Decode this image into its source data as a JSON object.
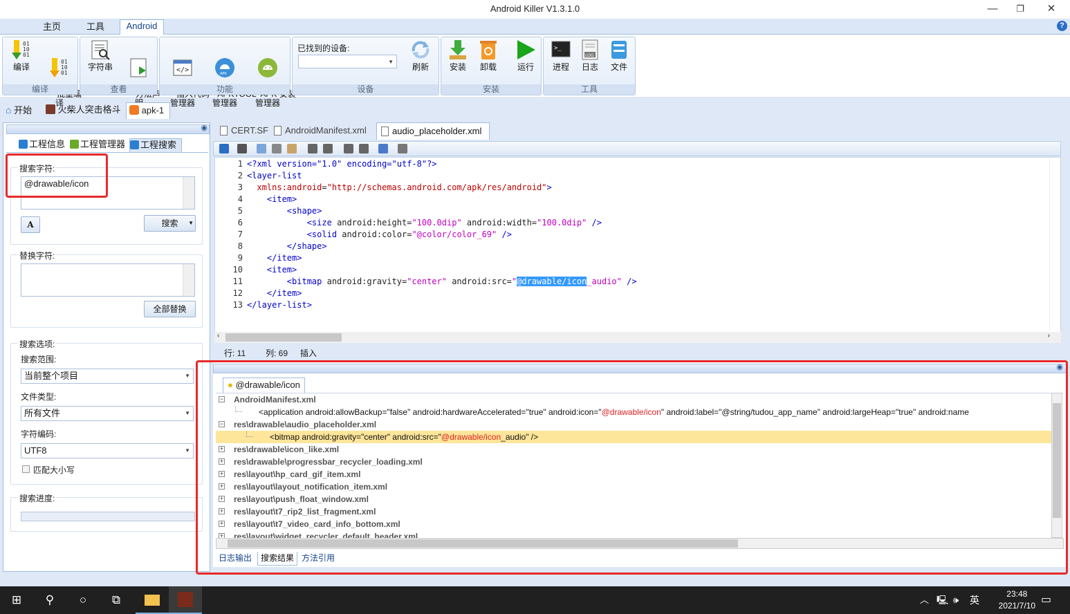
{
  "window": {
    "title": "Android Killer V1.3.1.0",
    "minimize": "—",
    "maximize": "❐",
    "close": "✕"
  },
  "menu_tabs": [
    "主页",
    "工具",
    "Android"
  ],
  "help": "?",
  "ribbon": {
    "groups": [
      {
        "label": "编译",
        "buttons": [
          {
            "label": "编译"
          },
          {
            "label": "批量编\n译"
          }
        ]
      },
      {
        "label": "查看",
        "buttons": [
          {
            "label": "字符串"
          },
          {
            "label": "方法声\n明"
          }
        ]
      },
      {
        "label": "功能",
        "buttons": [
          {
            "label": "插入代码\n管理器"
          },
          {
            "label": "APKTOOL\n管理器"
          },
          {
            "label": "APK 安装\n管理器"
          }
        ]
      },
      {
        "label": "设备",
        "device_label": "已找到的设备:",
        "buttons": [
          {
            "label": "刷新"
          }
        ]
      },
      {
        "label": "安装",
        "buttons": [
          {
            "label": "安装"
          },
          {
            "label": "卸载"
          }
        ]
      },
      {
        "label": "",
        "buttons": [
          {
            "label": "运行"
          }
        ]
      },
      {
        "label": "工具",
        "buttons": [
          {
            "label": "进程"
          },
          {
            "label": "日志"
          },
          {
            "label": "文件"
          }
        ]
      }
    ]
  },
  "doc_tabs": [
    "开始",
    "火柴人突击格斗",
    "apk-1"
  ],
  "left_panel": {
    "tabs": [
      "工程信息",
      "工程管理器",
      "工程搜索"
    ],
    "search_label": "搜索字符:",
    "search_value": "@drawable/icon",
    "search_button": "搜索",
    "replace_label": "替换字符:",
    "replace_all_button": "全部替换",
    "options_label": "搜索选项:",
    "scope_label": "搜索范围:",
    "scope_value": "当前整个项目",
    "filetype_label": "文件类型:",
    "filetype_value": "所有文件",
    "encoding_label": "字符编码:",
    "encoding_value": "UTF8",
    "match_case": "匹配大小写",
    "progress_label": "搜索进度:"
  },
  "editor": {
    "tabs": [
      "CERT.SF",
      "AndroidManifest.xml",
      "audio_placeholder.xml"
    ],
    "status": {
      "line": "行: 11",
      "col": "列: 69",
      "mode": "插入"
    }
  },
  "code_lines": [
    {
      "n": "1",
      "parts": [
        [
          "c-tag",
          "<?xml version=\"1.0\" encoding=\"utf-8\"?>"
        ]
      ]
    },
    {
      "n": "2",
      "parts": [
        [
          "c-tag",
          "<layer-list"
        ]
      ]
    },
    {
      "n": "3",
      "parts": [
        [
          "",
          "  "
        ],
        [
          "c-attr",
          "xmlns:android"
        ],
        [
          "c-attr2",
          "="
        ],
        [
          "c-attr",
          "\"http://schemas.android.com/apk/res/android\""
        ],
        [
          "c-tag",
          ">"
        ]
      ]
    },
    {
      "n": "4",
      "parts": [
        [
          "",
          "    "
        ],
        [
          "c-tag",
          "<item>"
        ]
      ]
    },
    {
      "n": "5",
      "parts": [
        [
          "",
          "        "
        ],
        [
          "c-tag",
          "<shape>"
        ]
      ]
    },
    {
      "n": "6",
      "parts": [
        [
          "",
          "            "
        ],
        [
          "c-tag",
          "<size "
        ],
        [
          "c-attr2",
          "android:height="
        ],
        [
          "c-val",
          "\"100.0dip\""
        ],
        [
          "c-attr2",
          " android:width="
        ],
        [
          "c-val",
          "\"100.0dip\""
        ],
        [
          "c-tag",
          " />"
        ]
      ]
    },
    {
      "n": "7",
      "parts": [
        [
          "",
          "            "
        ],
        [
          "c-tag",
          "<solid "
        ],
        [
          "c-attr2",
          "android:color="
        ],
        [
          "c-val",
          "\"@color/color_69\""
        ],
        [
          "c-tag",
          " />"
        ]
      ]
    },
    {
      "n": "8",
      "parts": [
        [
          "",
          "        "
        ],
        [
          "c-tag",
          "</shape>"
        ]
      ]
    },
    {
      "n": "9",
      "parts": [
        [
          "",
          "    "
        ],
        [
          "c-tag",
          "</item>"
        ]
      ]
    },
    {
      "n": "10",
      "parts": [
        [
          "",
          "    "
        ],
        [
          "c-tag",
          "<item>"
        ]
      ]
    },
    {
      "n": "11",
      "parts": [
        [
          "",
          "        "
        ],
        [
          "c-tag",
          "<bitmap "
        ],
        [
          "c-attr2",
          "android:gravity="
        ],
        [
          "c-val",
          "\"center\""
        ],
        [
          "c-attr2",
          " android:src="
        ],
        [
          "c-val",
          "\""
        ],
        [
          "hl",
          "@drawable/icon"
        ],
        [
          "c-val",
          "_audio\""
        ],
        [
          "c-tag",
          " />"
        ]
      ]
    },
    {
      "n": "12",
      "parts": [
        [
          "",
          "    "
        ],
        [
          "c-tag",
          "</item>"
        ]
      ]
    },
    {
      "n": "13",
      "parts": [
        [
          "c-tag",
          "</layer-list>"
        ]
      ]
    }
  ],
  "results": {
    "tab": "@drawable/icon",
    "rows": [
      {
        "type": "file",
        "pm": "⊟",
        "text": "AndroidManifest.xml"
      },
      {
        "type": "match",
        "pre": "<application android:allowBackup=\"false\" android:hardwareAccelerated=\"true\" android:icon=\"",
        "hit": "@drawable/icon",
        "post": "\" android:label=\"@string/tudou_app_name\" android:largeHeap=\"true\" android:name"
      },
      {
        "type": "file",
        "pm": "⊟",
        "text": "res\\drawable\\audio_placeholder.xml"
      },
      {
        "type": "match",
        "selected": true,
        "pre": "<bitmap android:gravity=\"center\" android:src=\"",
        "hit": "@drawable/icon",
        "post": "_audio\" />"
      },
      {
        "type": "file",
        "pm": "⊞",
        "text": "res\\drawable\\icon_like.xml"
      },
      {
        "type": "file",
        "pm": "⊞",
        "text": "res\\drawable\\progressbar_recycler_loading.xml"
      },
      {
        "type": "file",
        "pm": "⊞",
        "text": "res\\layout\\hp_card_gif_item.xml"
      },
      {
        "type": "file",
        "pm": "⊞",
        "text": "res\\layout\\layout_notification_item.xml"
      },
      {
        "type": "file",
        "pm": "⊞",
        "text": "res\\layout\\push_float_window.xml"
      },
      {
        "type": "file",
        "pm": "⊞",
        "text": "res\\layout\\t7_rip2_list_fragment.xml"
      },
      {
        "type": "file",
        "pm": "⊞",
        "text": "res\\layout\\t7_video_card_info_bottom.xml"
      },
      {
        "type": "file",
        "pm": "⊞",
        "text": "res\\layout\\widget_recycler_default_header.xml"
      }
    ],
    "bottom_tabs": [
      "日志输出",
      "搜索结果",
      "方法引用"
    ]
  },
  "taskbar": {
    "time": "23:48",
    "date": "2021/7/10",
    "ime": "英"
  }
}
